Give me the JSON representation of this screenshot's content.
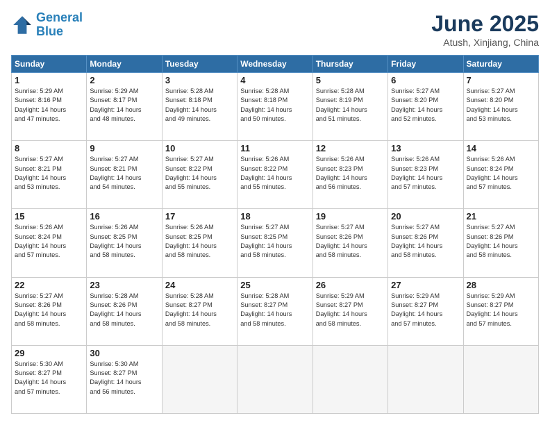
{
  "logo": {
    "line1": "General",
    "line2": "Blue"
  },
  "title": "June 2025",
  "location": "Atush, Xinjiang, China",
  "days_of_week": [
    "Sunday",
    "Monday",
    "Tuesday",
    "Wednesday",
    "Thursday",
    "Friday",
    "Saturday"
  ],
  "weeks": [
    [
      {
        "day": 1,
        "info": "Sunrise: 5:29 AM\nSunset: 8:16 PM\nDaylight: 14 hours\nand 47 minutes."
      },
      {
        "day": 2,
        "info": "Sunrise: 5:29 AM\nSunset: 8:17 PM\nDaylight: 14 hours\nand 48 minutes."
      },
      {
        "day": 3,
        "info": "Sunrise: 5:28 AM\nSunset: 8:18 PM\nDaylight: 14 hours\nand 49 minutes."
      },
      {
        "day": 4,
        "info": "Sunrise: 5:28 AM\nSunset: 8:18 PM\nDaylight: 14 hours\nand 50 minutes."
      },
      {
        "day": 5,
        "info": "Sunrise: 5:28 AM\nSunset: 8:19 PM\nDaylight: 14 hours\nand 51 minutes."
      },
      {
        "day": 6,
        "info": "Sunrise: 5:27 AM\nSunset: 8:20 PM\nDaylight: 14 hours\nand 52 minutes."
      },
      {
        "day": 7,
        "info": "Sunrise: 5:27 AM\nSunset: 8:20 PM\nDaylight: 14 hours\nand 53 minutes."
      }
    ],
    [
      {
        "day": 8,
        "info": "Sunrise: 5:27 AM\nSunset: 8:21 PM\nDaylight: 14 hours\nand 53 minutes."
      },
      {
        "day": 9,
        "info": "Sunrise: 5:27 AM\nSunset: 8:21 PM\nDaylight: 14 hours\nand 54 minutes."
      },
      {
        "day": 10,
        "info": "Sunrise: 5:27 AM\nSunset: 8:22 PM\nDaylight: 14 hours\nand 55 minutes."
      },
      {
        "day": 11,
        "info": "Sunrise: 5:26 AM\nSunset: 8:22 PM\nDaylight: 14 hours\nand 55 minutes."
      },
      {
        "day": 12,
        "info": "Sunrise: 5:26 AM\nSunset: 8:23 PM\nDaylight: 14 hours\nand 56 minutes."
      },
      {
        "day": 13,
        "info": "Sunrise: 5:26 AM\nSunset: 8:23 PM\nDaylight: 14 hours\nand 57 minutes."
      },
      {
        "day": 14,
        "info": "Sunrise: 5:26 AM\nSunset: 8:24 PM\nDaylight: 14 hours\nand 57 minutes."
      }
    ],
    [
      {
        "day": 15,
        "info": "Sunrise: 5:26 AM\nSunset: 8:24 PM\nDaylight: 14 hours\nand 57 minutes."
      },
      {
        "day": 16,
        "info": "Sunrise: 5:26 AM\nSunset: 8:25 PM\nDaylight: 14 hours\nand 58 minutes."
      },
      {
        "day": 17,
        "info": "Sunrise: 5:26 AM\nSunset: 8:25 PM\nDaylight: 14 hours\nand 58 minutes."
      },
      {
        "day": 18,
        "info": "Sunrise: 5:27 AM\nSunset: 8:25 PM\nDaylight: 14 hours\nand 58 minutes."
      },
      {
        "day": 19,
        "info": "Sunrise: 5:27 AM\nSunset: 8:26 PM\nDaylight: 14 hours\nand 58 minutes."
      },
      {
        "day": 20,
        "info": "Sunrise: 5:27 AM\nSunset: 8:26 PM\nDaylight: 14 hours\nand 58 minutes."
      },
      {
        "day": 21,
        "info": "Sunrise: 5:27 AM\nSunset: 8:26 PM\nDaylight: 14 hours\nand 58 minutes."
      }
    ],
    [
      {
        "day": 22,
        "info": "Sunrise: 5:27 AM\nSunset: 8:26 PM\nDaylight: 14 hours\nand 58 minutes."
      },
      {
        "day": 23,
        "info": "Sunrise: 5:28 AM\nSunset: 8:26 PM\nDaylight: 14 hours\nand 58 minutes."
      },
      {
        "day": 24,
        "info": "Sunrise: 5:28 AM\nSunset: 8:27 PM\nDaylight: 14 hours\nand 58 minutes."
      },
      {
        "day": 25,
        "info": "Sunrise: 5:28 AM\nSunset: 8:27 PM\nDaylight: 14 hours\nand 58 minutes."
      },
      {
        "day": 26,
        "info": "Sunrise: 5:29 AM\nSunset: 8:27 PM\nDaylight: 14 hours\nand 58 minutes."
      },
      {
        "day": 27,
        "info": "Sunrise: 5:29 AM\nSunset: 8:27 PM\nDaylight: 14 hours\nand 57 minutes."
      },
      {
        "day": 28,
        "info": "Sunrise: 5:29 AM\nSunset: 8:27 PM\nDaylight: 14 hours\nand 57 minutes."
      }
    ],
    [
      {
        "day": 29,
        "info": "Sunrise: 5:30 AM\nSunset: 8:27 PM\nDaylight: 14 hours\nand 57 minutes."
      },
      {
        "day": 30,
        "info": "Sunrise: 5:30 AM\nSunset: 8:27 PM\nDaylight: 14 hours\nand 56 minutes."
      },
      {
        "day": null,
        "info": ""
      },
      {
        "day": null,
        "info": ""
      },
      {
        "day": null,
        "info": ""
      },
      {
        "day": null,
        "info": ""
      },
      {
        "day": null,
        "info": ""
      }
    ]
  ]
}
